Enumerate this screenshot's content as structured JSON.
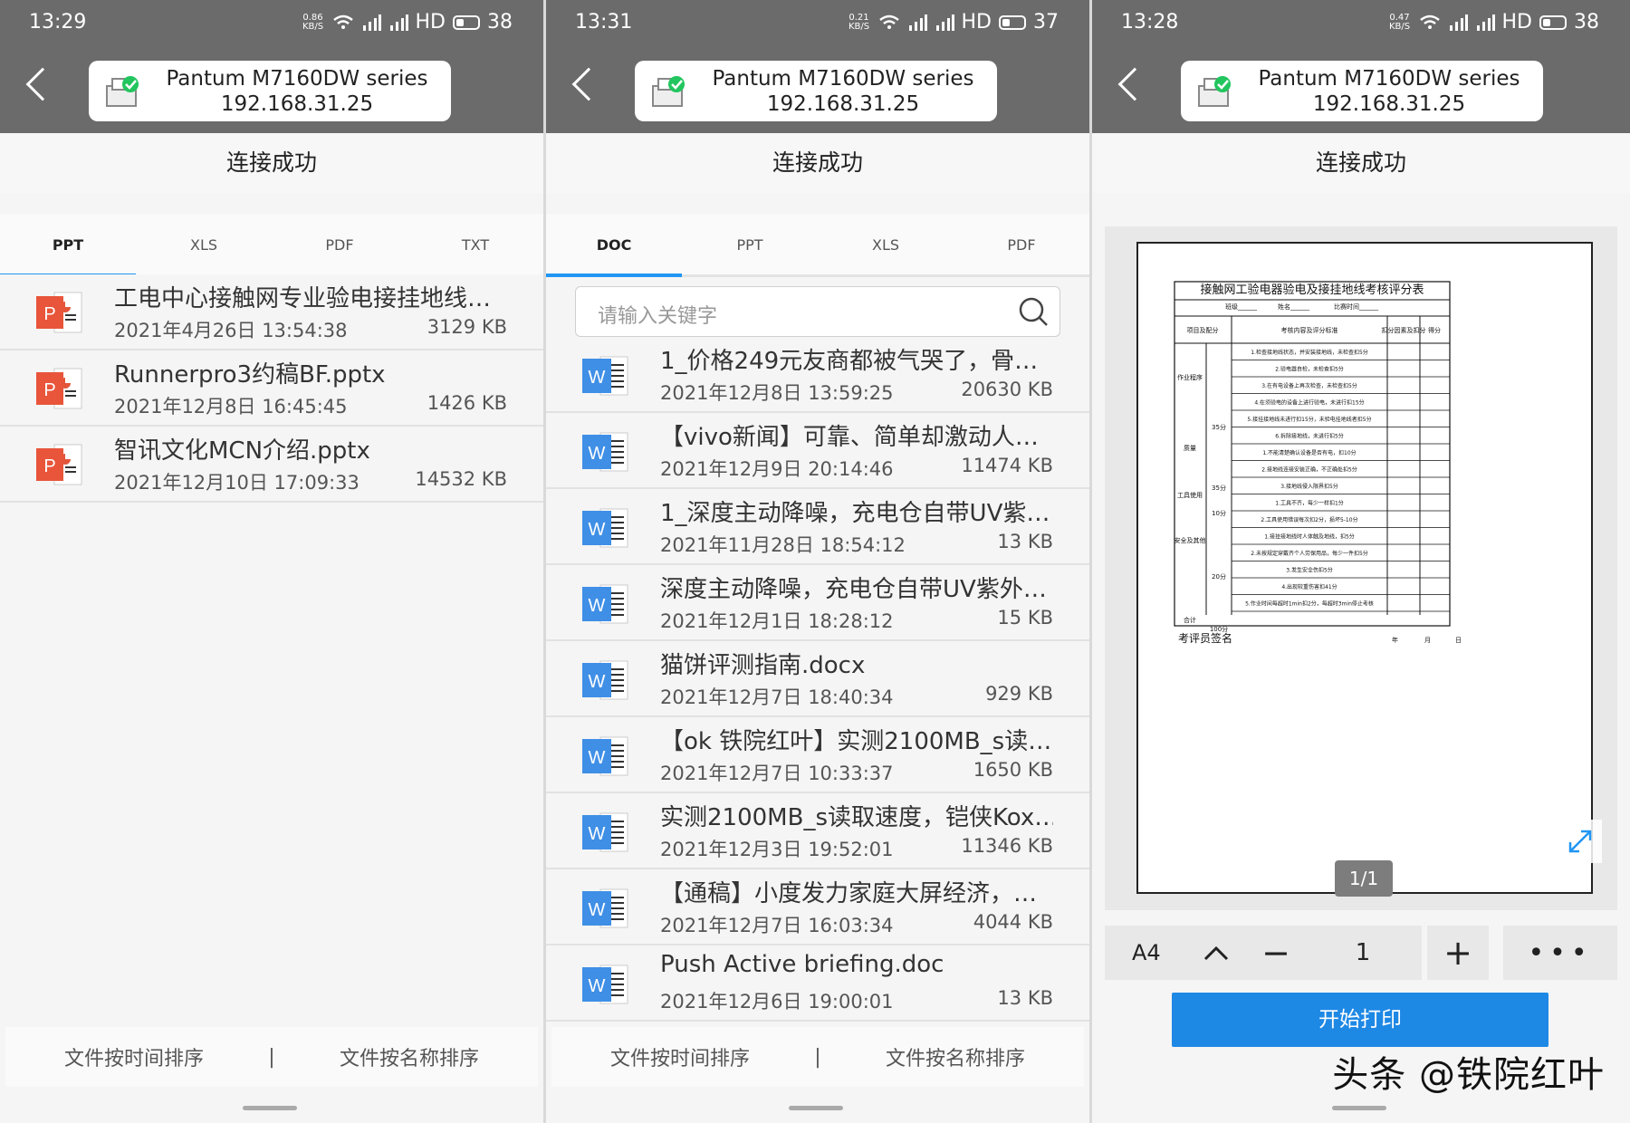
{
  "printer": {
    "name": "Pantum M7160DW series",
    "ip": "192.168.31.25"
  },
  "connection_status": "连接成功",
  "search_placeholder": "请输入关键字",
  "sort": {
    "by_time": "文件按时间排序",
    "separator": "|",
    "by_name": "文件按名称排序"
  },
  "colors": {
    "accent": "#2196f3",
    "topbar": "#6b6b6b",
    "print_button": "#1e88e5"
  },
  "screens": [
    {
      "status": {
        "time": "13:29",
        "speed_top": "0.86",
        "speed_bottom": "KB/S",
        "net": "4G",
        "hd": "HD",
        "battery": "38"
      },
      "tabs": [
        "PPT",
        "XLS",
        "PDF",
        "TXT"
      ],
      "active_tab": "PPT",
      "files": [
        {
          "type": "ppt",
          "name": "工电中心接触网专业验电接挂地线…",
          "date": "2021年4月26日 13:54:38",
          "size": "3129 KB"
        },
        {
          "type": "ppt",
          "name": "Runnerpro3约稿BF.pptx",
          "date": "2021年12月8日 16:45:45",
          "size": "1426 KB"
        },
        {
          "type": "ppt",
          "name": "智讯文化MCN介绍.pptx",
          "date": "2021年12月10日 17:09:33",
          "size": "14532 KB"
        }
      ]
    },
    {
      "status": {
        "time": "13:31",
        "speed_top": "0.21",
        "speed_bottom": "KB/S",
        "net": "4G",
        "hd": "HD",
        "battery": "37"
      },
      "tabs": [
        "DOC",
        "PPT",
        "XLS",
        "PDF"
      ],
      "active_tab": "DOC",
      "files": [
        {
          "type": "doc",
          "name": "1_价格249元友商都被气哭了，骨…",
          "date": "2021年12月8日 13:59:25",
          "size": "20630 KB"
        },
        {
          "type": "doc",
          "name": "【vivo新闻】可靠、简单却激动人…",
          "date": "2021年12月9日 20:14:46",
          "size": "11474 KB"
        },
        {
          "type": "doc",
          "name": "1_深度主动降噪，充电仓自带UV紫…",
          "date": "2021年11月28日 18:54:12",
          "size": "13 KB"
        },
        {
          "type": "doc",
          "name": "深度主动降噪，充电仓自带UV紫外…",
          "date": "2021年12月1日 18:28:12",
          "size": "15 KB"
        },
        {
          "type": "doc",
          "name": "猫饼评测指南.docx",
          "date": "2021年12月7日 18:40:34",
          "size": "929 KB"
        },
        {
          "type": "doc",
          "name": "【ok 铁院红叶】实测2100MB_s读…",
          "date": "2021年12月7日 10:33:37",
          "size": "1650 KB"
        },
        {
          "type": "doc",
          "name": "实测2100MB_s读取速度，铠侠Kox…",
          "date": "2021年12月3日 19:52:01",
          "size": "11346 KB"
        },
        {
          "type": "doc",
          "name": "【通稿】小度发力家庭大屏经济，…",
          "date": "2021年12月7日 16:03:34",
          "size": "4044 KB"
        },
        {
          "type": "doc",
          "name": "Push Active briefing.doc",
          "date": "2021年12月6日 19:00:01",
          "size": "13 KB"
        }
      ]
    },
    {
      "status": {
        "time": "13:28",
        "speed_top": "0.47",
        "speed_bottom": "KB/S",
        "net": "4G",
        "hd": "HD",
        "battery": "38"
      }
    }
  ],
  "preview": {
    "doc_title": "接触网工验电器验电及接挂地线考核评分表",
    "doc_info": [
      "班级______",
      "姓名______",
      "比赛时间______"
    ],
    "doc_headers": [
      "项目及配分",
      "考核内容及评分标准",
      "扣分因素及扣分",
      "得分"
    ],
    "doc_rows": [
      "1.检查接地线状态，并安装接地线，未检查扣5分",
      "2.验电器自检，未检查扣5分",
      "3.在有电设备上再次检查，未检查扣5分",
      "4.在须验电的设备上进行验电，未进行扣15分",
      "5.接挂接地线未进行扣15分，未验电挂地线者扣5分",
      "6.拆除接地线，未进行扣5分",
      "1.不能清楚确认设备是否有电，扣10分",
      "2.接地线连接安装正确，不正确处扣5分",
      "3.接地线侵入限界扣5分",
      "1.工具不齐，每少一样扣1分",
      "2.工具使用错误每次扣2分，损坏5-10分",
      "1.接挂接地线时人体触及地线，扣5分",
      "2.未按规定穿戴齐个人劳保用品，每少一件扣5分",
      "3.发生安全伤扣5分",
      "4.出现较重伤害扣41分",
      "5.作业时间每超时1min扣2分，每超时3min停止考核"
    ],
    "doc_sections": [
      "作业程序",
      "35分",
      "质量",
      "35分",
      "工具使用",
      "10分",
      "安全及其他",
      "20分",
      "合计",
      "100分"
    ],
    "doc_signature": "考评员签名",
    "doc_date": [
      "年",
      "月",
      "日"
    ],
    "page_indicator": "1/1",
    "paper_size": "A4",
    "copies": "1",
    "minus_label": "−",
    "plus_label": "+",
    "more_label": "•••",
    "print_label": "开始打印"
  },
  "watermark": "头条 @铁院红叶"
}
